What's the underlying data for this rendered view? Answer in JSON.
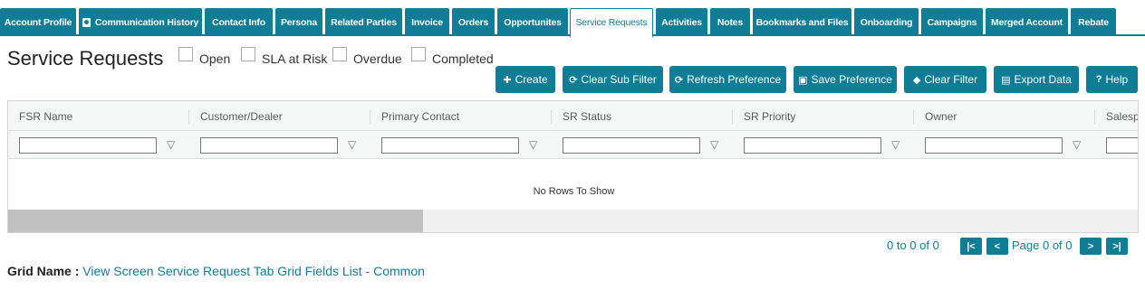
{
  "tabs": [
    {
      "label": "Account Profile"
    },
    {
      "label": "Communication History"
    },
    {
      "label": "Contact Info"
    },
    {
      "label": "Persona"
    },
    {
      "label": "Related Parties"
    },
    {
      "label": "Invoice"
    },
    {
      "label": "Orders"
    },
    {
      "label": "Opportunites"
    },
    {
      "label": "Service Requests"
    },
    {
      "label": "Activities"
    },
    {
      "label": "Notes"
    },
    {
      "label": "Bookmarks and Files"
    },
    {
      "label": "Onboarding"
    },
    {
      "label": "Campaigns"
    },
    {
      "label": "Merged Account"
    },
    {
      "label": "Rebate"
    }
  ],
  "page": {
    "title": "Service Requests"
  },
  "filters": {
    "open": "Open",
    "sla_at_risk": "SLA at Risk",
    "overdue": "Overdue",
    "completed": "Completed"
  },
  "toolbar": {
    "create": "Create",
    "clear_sub_filter": "Clear Sub Filter",
    "refresh_preference": "Refresh Preference",
    "save_preference": "Save Preference",
    "clear_filter": "Clear Filter",
    "export_data": "Export Data",
    "help": "Help"
  },
  "grid": {
    "columns": [
      "FSR Name",
      "Customer/Dealer",
      "Primary Contact",
      "SR Status",
      "SR Priority",
      "Owner",
      "Salesperson"
    ],
    "empty_message": "No Rows To Show"
  },
  "pager": {
    "summary": "0 to 0 of 0",
    "page_text": "Page 0 of 0"
  },
  "footer": {
    "grid_name_label": "Grid Name :",
    "grid_name_value": "View Screen Service Request Tab Grid Fields List - Common"
  },
  "colors": {
    "accent": "#0f7d96"
  }
}
